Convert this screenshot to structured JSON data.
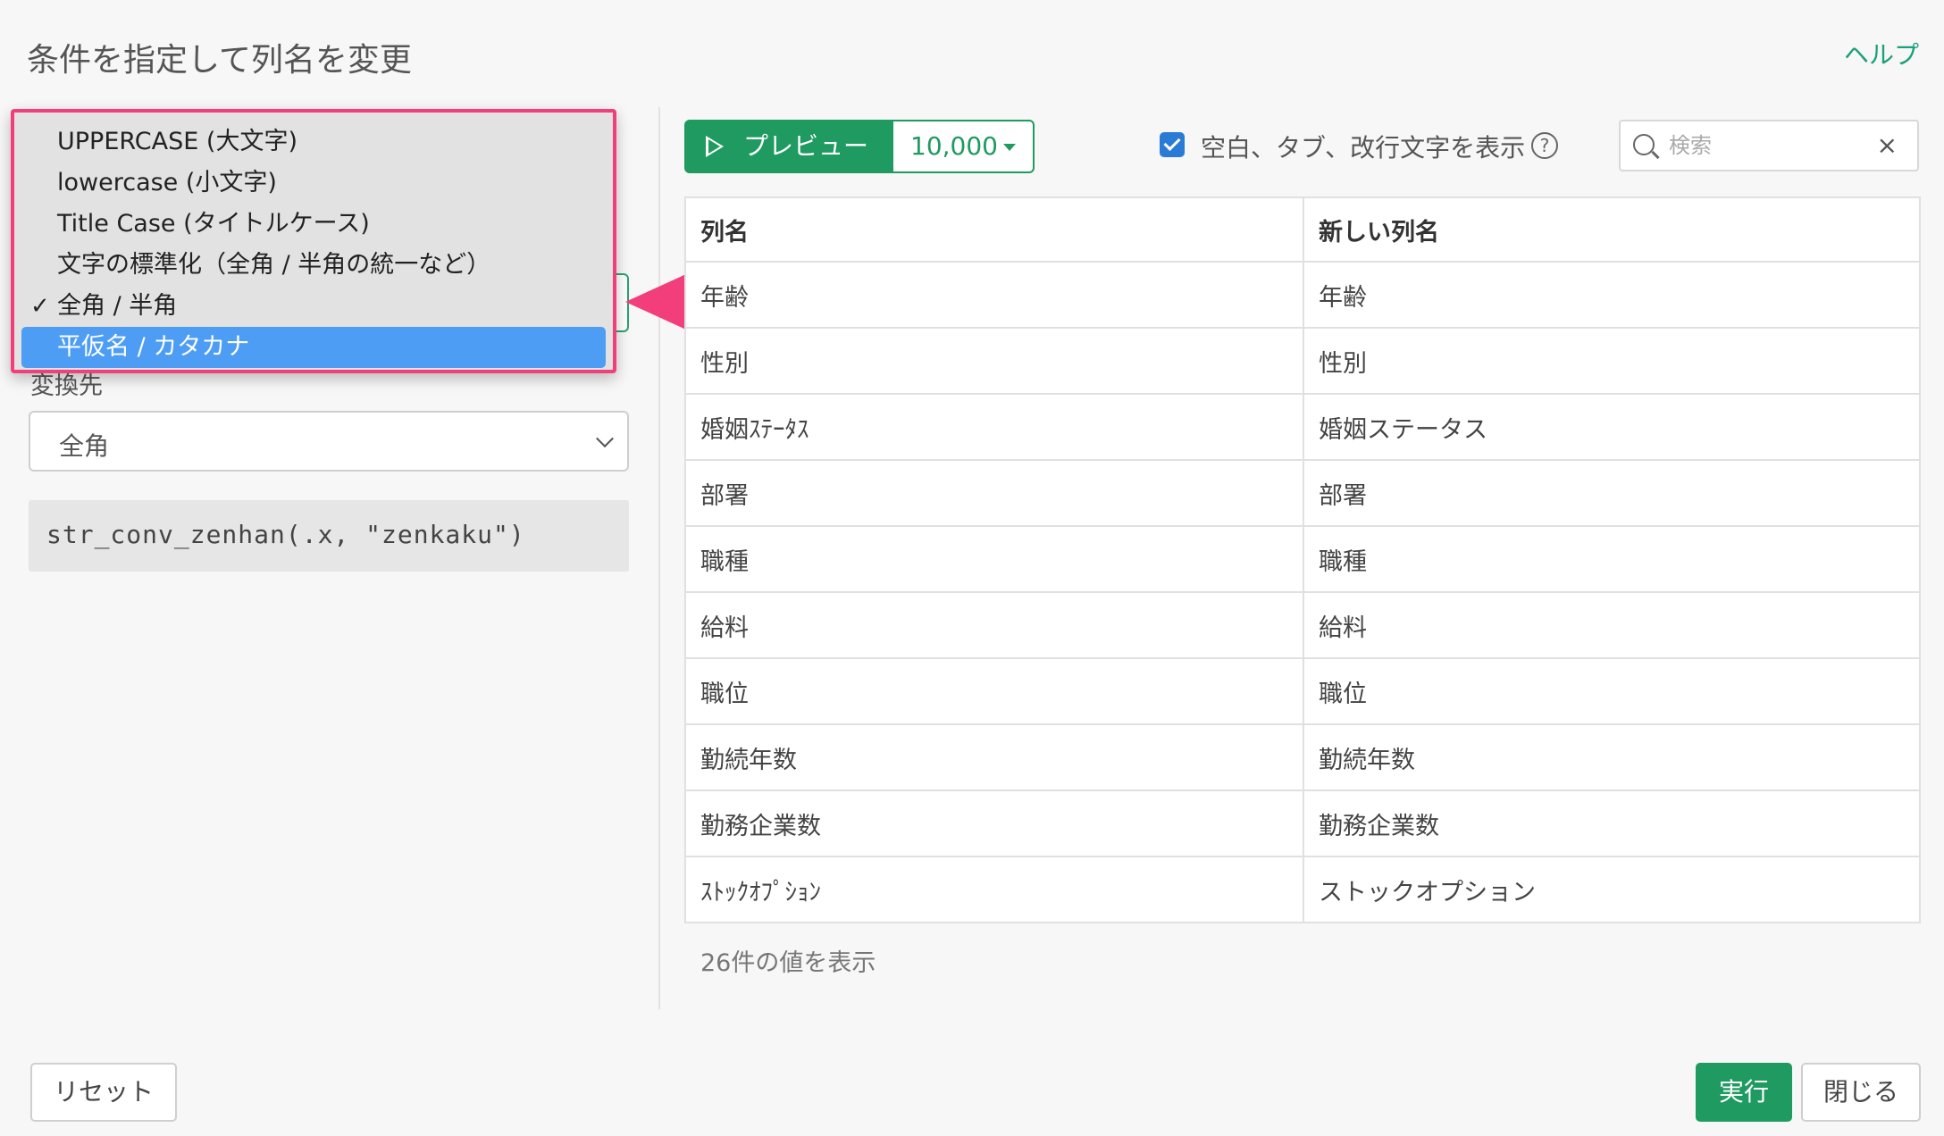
{
  "dialog": {
    "title": "条件を指定して列名を変更",
    "help": "ヘルプ"
  },
  "dropdown": {
    "items": [
      {
        "label": "UPPERCASE (大文字)",
        "check": ""
      },
      {
        "label": "lowercase (小文字)",
        "check": ""
      },
      {
        "label": "Title Case (タイトルケース)",
        "check": ""
      },
      {
        "label": "文字の標準化（全角 / 半角の統一など）",
        "check": ""
      },
      {
        "label": "全角 / 半角",
        "check": "✓"
      },
      {
        "label": "平仮名 / カタカナ",
        "check": ""
      }
    ],
    "highlighted_index": 5
  },
  "target": {
    "label": "変換先",
    "value": "全角"
  },
  "code": "str_conv_zenhan(.x, \"zenkaku\")",
  "toolbar": {
    "preview_label": "プレビュー",
    "count_label": "10,000",
    "whitespace_label": "空白、タブ、改行文字を表示",
    "help_icon": "?",
    "search_placeholder": "検索",
    "clear_icon": "×"
  },
  "table": {
    "headers": [
      "列名",
      "新しい列名"
    ],
    "rows": [
      [
        "年齢",
        "年齢"
      ],
      [
        "性別",
        "性別"
      ],
      [
        "婚姻ｽﾃｰﾀｽ",
        "婚姻ステータス"
      ],
      [
        "部署",
        "部署"
      ],
      [
        "職種",
        "職種"
      ],
      [
        "給料",
        "給料"
      ],
      [
        "職位",
        "職位"
      ],
      [
        "勤続年数",
        "勤続年数"
      ],
      [
        "勤務企業数",
        "勤務企業数"
      ],
      [
        "ｽﾄｯｸｵﾌﾟｼｮﾝ",
        "ストックオプション"
      ]
    ]
  },
  "footer_note": "26件の値を表示",
  "buttons": {
    "reset": "リセット",
    "run": "実行",
    "close": "閉じる"
  },
  "colors": {
    "accent_green": "#1f9a61",
    "highlight_border": "#f23e7a",
    "selection_blue": "#4e9df5"
  }
}
